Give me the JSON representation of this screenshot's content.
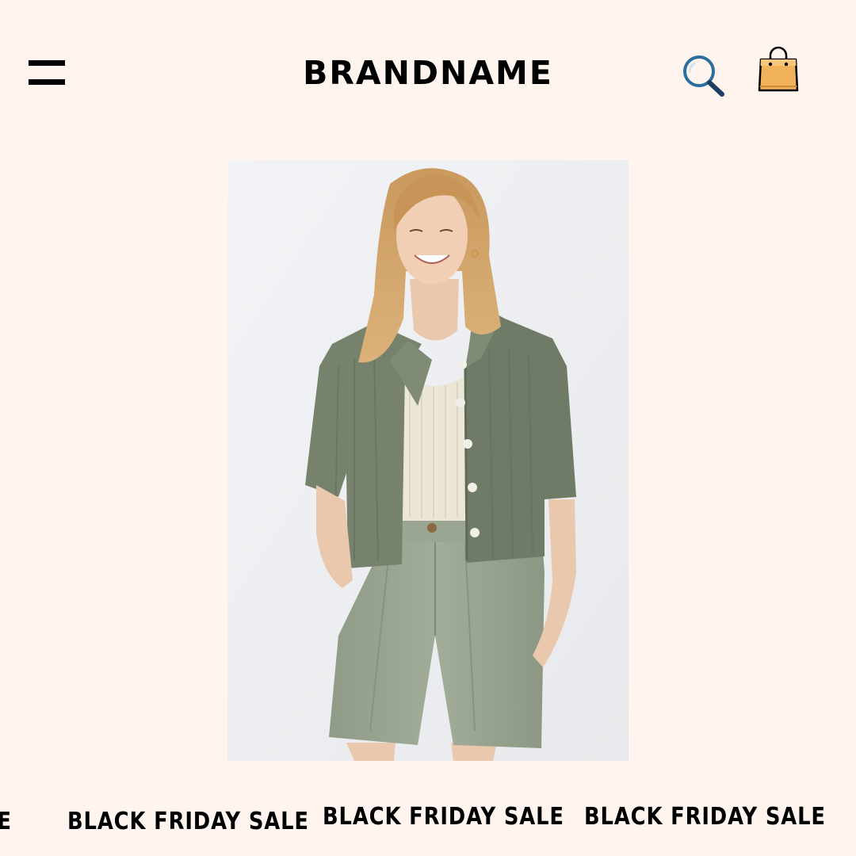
{
  "header": {
    "brand": "BRANDNAME",
    "menu_icon": "hamburger-menu-icon",
    "search_icon": "search-icon",
    "cart_icon": "shopping-bag-icon"
  },
  "product": {
    "image": "product-photo"
  },
  "marquee": {
    "items": [
      "BLACK FRIDAY SALE",
      "BLACK FRIDAY SALE",
      "BLACK FRIDAY SALE",
      "BLACK FRIDAY SALE"
    ]
  },
  "colors": {
    "background": "#fff5ee",
    "search_icon": "#2a6f9e",
    "bag_fill": "#f2b25b",
    "text": "#000000"
  }
}
